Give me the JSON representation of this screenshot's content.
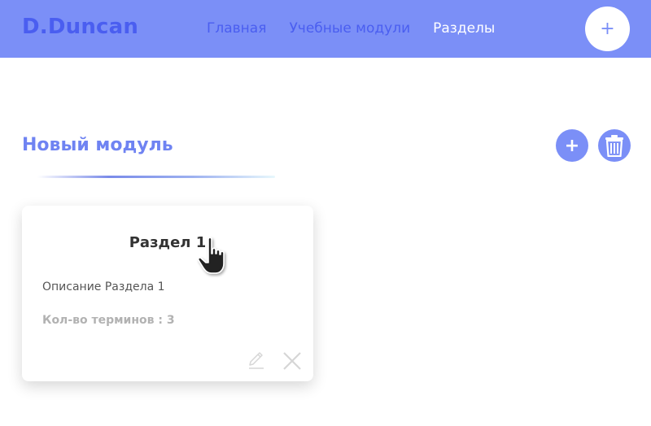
{
  "header": {
    "brand": "D.Duncan",
    "nav": [
      "Главная",
      "Учебные модули",
      "Разделы"
    ],
    "active_index": 2,
    "add_label": "+"
  },
  "module": {
    "title": "Новый модуль",
    "add_label": "+"
  },
  "card": {
    "title": "Раздел 1",
    "description": "Описание Раздела 1",
    "count": "Кол-во терминов : 3"
  },
  "icons": {
    "add": "plus-icon",
    "trash": "trash-icon",
    "edit": "pencil-icon",
    "close": "close-icon",
    "cursor": "hand-pointer-icon"
  },
  "colors": {
    "accent": "#7b8ff7",
    "brand_text": "#4a5ef0"
  }
}
